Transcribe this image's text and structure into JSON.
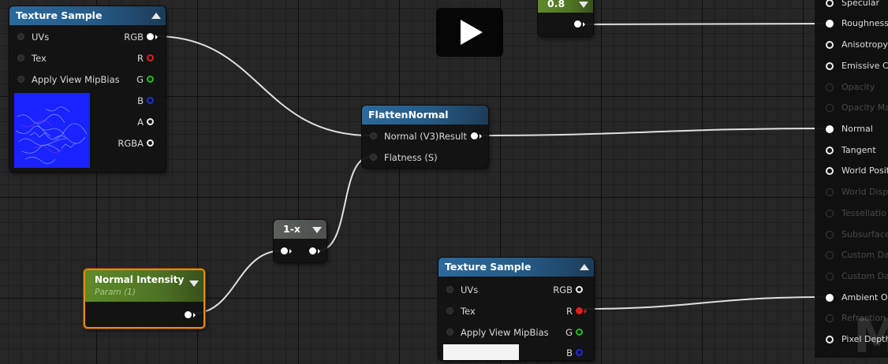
{
  "colors": {
    "texture_header": "#2b6a9e",
    "param_header": "#5e8a2a",
    "const_header": "#4f7424",
    "selection_outline": "#e88a10",
    "wire": "#e0e0e0",
    "pin_red": "#e02020",
    "pin_green": "#20c020",
    "pin_blue": "#1e2fd0"
  },
  "texture_sample_1": {
    "title": "Texture Sample",
    "inputs": [
      "UVs",
      "Tex",
      "Apply View MipBias"
    ],
    "outputs": [
      "RGB",
      "R",
      "G",
      "B",
      "A",
      "RGBA"
    ]
  },
  "const_node": {
    "value": "0.8"
  },
  "flatten_normal": {
    "title": "FlattenNormal",
    "inputs": [
      "Normal (V3)",
      "Flatness (S)"
    ],
    "output": "Result"
  },
  "one_minus": {
    "title": "1-x"
  },
  "normal_intensity": {
    "title": "Normal Intensity",
    "subtitle": "Param (1)"
  },
  "texture_sample_2": {
    "title": "Texture Sample",
    "inputs": [
      "UVs",
      "Tex",
      "Apply View MipBias"
    ],
    "outputs": [
      "RGB",
      "R",
      "G",
      "B"
    ]
  },
  "material_result": {
    "pins": [
      {
        "label": "Specular",
        "enabled": true
      },
      {
        "label": "Roughness",
        "enabled": true
      },
      {
        "label": "Anisotropy",
        "enabled": true
      },
      {
        "label": "Emissive C",
        "enabled": true
      },
      {
        "label": "Opacity",
        "enabled": false
      },
      {
        "label": "Opacity Ma",
        "enabled": false
      },
      {
        "label": "Normal",
        "enabled": true
      },
      {
        "label": "Tangent",
        "enabled": true
      },
      {
        "label": "World Posit",
        "enabled": true
      },
      {
        "label": "World Displ",
        "enabled": false
      },
      {
        "label": "Tessellatio",
        "enabled": false
      },
      {
        "label": "Subsurface",
        "enabled": false
      },
      {
        "label": "Custom Da",
        "enabled": false
      },
      {
        "label": "Custom Da",
        "enabled": false
      },
      {
        "label": "Ambient Oc",
        "enabled": true
      },
      {
        "label": "Refraction",
        "enabled": false
      },
      {
        "label": "Pixel Depth",
        "enabled": true
      }
    ]
  },
  "video_overlay": {
    "icon": "play-icon"
  }
}
